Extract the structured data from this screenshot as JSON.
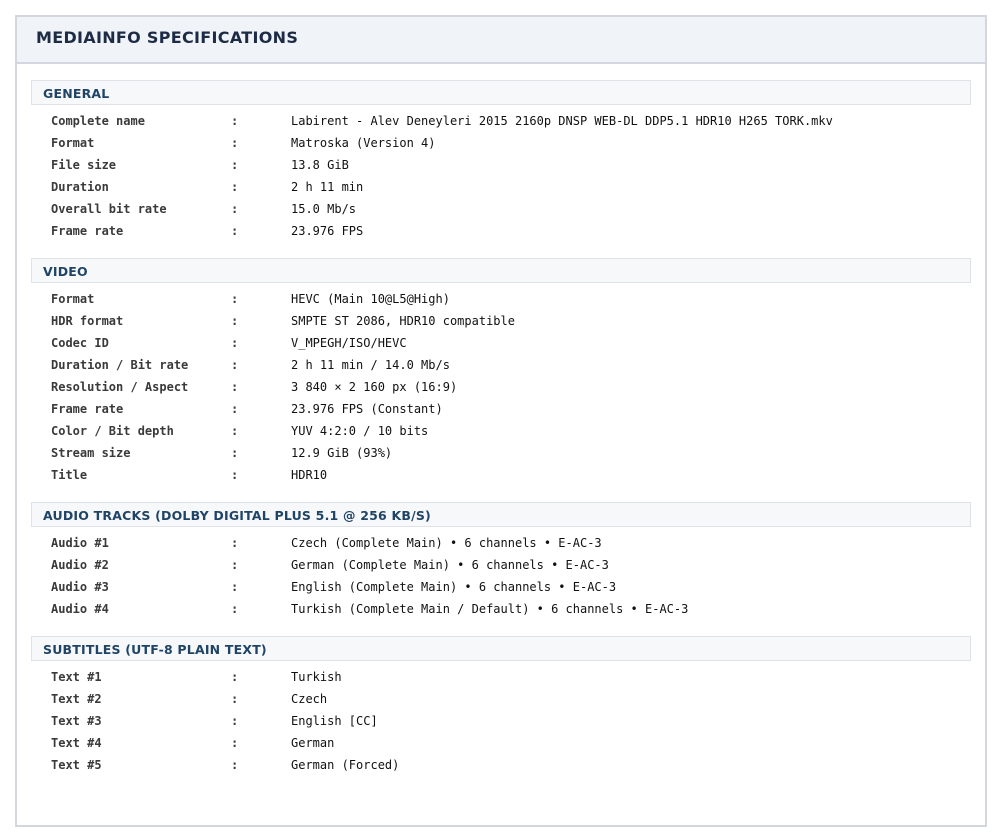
{
  "title": "MEDIAINFO SPECIFICATIONS",
  "separator": ":",
  "sections": [
    {
      "title": "GENERAL",
      "rows": [
        {
          "key": "Complete name",
          "value": "Labirent - Alev Deneyleri 2015 2160p DNSP WEB-DL DDP5.1 HDR10 H265 TORK.mkv"
        },
        {
          "key": "Format",
          "value": "Matroska (Version 4)"
        },
        {
          "key": "File size",
          "value": "13.8 GiB"
        },
        {
          "key": "Duration",
          "value": "2 h 11 min"
        },
        {
          "key": "Overall bit rate",
          "value": "15.0 Mb/s"
        },
        {
          "key": "Frame rate",
          "value": "23.976 FPS"
        }
      ]
    },
    {
      "title": "VIDEO",
      "rows": [
        {
          "key": "Format",
          "value": "HEVC (Main 10@L5@High)"
        },
        {
          "key": "HDR format",
          "value": "SMPTE ST 2086, HDR10 compatible"
        },
        {
          "key": "Codec ID",
          "value": "V_MPEGH/ISO/HEVC"
        },
        {
          "key": "Duration / Bit rate",
          "value": "2 h 11 min / 14.0 Mb/s"
        },
        {
          "key": "Resolution / Aspect",
          "value": "3 840 × 2 160 px (16:9)"
        },
        {
          "key": "Frame rate",
          "value": "23.976 FPS (Constant)"
        },
        {
          "key": "Color / Bit depth",
          "value": "YUV 4:2:0 / 10 bits"
        },
        {
          "key": "Stream size",
          "value": "12.9 GiB (93%)"
        },
        {
          "key": "Title",
          "value": "HDR10"
        }
      ]
    },
    {
      "title": "AUDIO TRACKS (DOLBY DIGITAL PLUS 5.1 @ 256 KB/S)",
      "rows": [
        {
          "key": "Audio #1",
          "value": "Czech (Complete Main) • 6 channels • E-AC-3"
        },
        {
          "key": "Audio #2",
          "value": "German (Complete Main) • 6 channels • E-AC-3"
        },
        {
          "key": "Audio #3",
          "value": "English (Complete Main) • 6 channels • E-AC-3"
        },
        {
          "key": "Audio #4",
          "value": "Turkish (Complete Main / Default) • 6 channels • E-AC-3"
        }
      ]
    },
    {
      "title": "SUBTITLES (UTF-8 PLAIN TEXT)",
      "rows": [
        {
          "key": "Text #1",
          "value": "Turkish"
        },
        {
          "key": "Text #2",
          "value": "Czech"
        },
        {
          "key": "Text #3",
          "value": "English [CC]"
        },
        {
          "key": "Text #4",
          "value": "German"
        },
        {
          "key": "Text #5",
          "value": "German (Forced)"
        }
      ]
    }
  ]
}
